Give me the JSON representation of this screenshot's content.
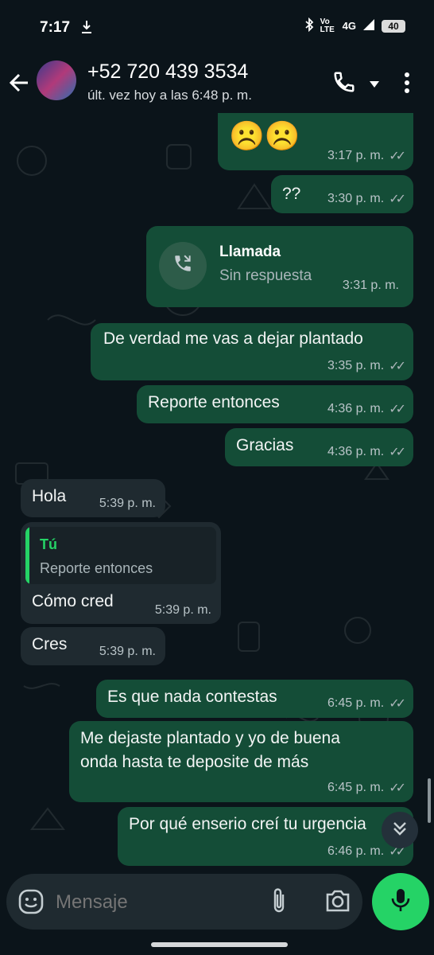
{
  "status_bar": {
    "time": "7:17",
    "network": "4G",
    "volte": "Vo LTE",
    "battery": "40"
  },
  "header": {
    "contact_name": "+52 720 439 3534",
    "last_seen": "últ. vez hoy a las 6:48 p. m.",
    "icons": [
      "back-arrow-icon",
      "avatar",
      "phone-icon",
      "dropdown-icon",
      "more-vert-icon"
    ]
  },
  "messages": [
    {
      "dir": "out",
      "text": "☹️☹️",
      "time": "3:17 p. m.",
      "status": "read"
    },
    {
      "dir": "out",
      "text": "??",
      "time": "3:30 p. m.",
      "status": "read"
    },
    {
      "dir": "out",
      "type": "call",
      "call_title": "Llamada",
      "call_status": "Sin respuesta",
      "time": "3:31 p. m."
    },
    {
      "dir": "out",
      "text": "De verdad me vas a dejar plantado",
      "time": "3:35 p. m.",
      "status": "read"
    },
    {
      "dir": "out",
      "text": "Reporte entonces",
      "time": "4:36 p. m.",
      "status": "read"
    },
    {
      "dir": "out",
      "text": "Gracias",
      "time": "4:36 p. m.",
      "status": "read"
    },
    {
      "dir": "in",
      "text": "Hola",
      "time": "5:39 p. m."
    },
    {
      "dir": "in",
      "quote_author": "Tú",
      "quote_text": "Reporte entonces",
      "text": "Cómo cred",
      "time": "5:39 p. m."
    },
    {
      "dir": "in",
      "text": "Cres",
      "time": "5:39 p. m."
    },
    {
      "dir": "out",
      "text": "Es que nada contestas",
      "time": "6:45 p. m.",
      "status": "read"
    },
    {
      "dir": "out",
      "text_line1": "Me dejaste plantado y yo de buena",
      "text_line2": "onda hasta te deposite de más",
      "time": "6:45 p. m.",
      "status": "read"
    },
    {
      "dir": "out",
      "text": "Por qué enserio creí tu urgencia",
      "time": "6:46 p. m.",
      "status": "read"
    }
  ],
  "input": {
    "placeholder": "Mensaje"
  },
  "colors": {
    "background": "#0b141a",
    "outgoing": "#144d37",
    "incoming": "#1f2a30",
    "accent": "#25d366"
  }
}
